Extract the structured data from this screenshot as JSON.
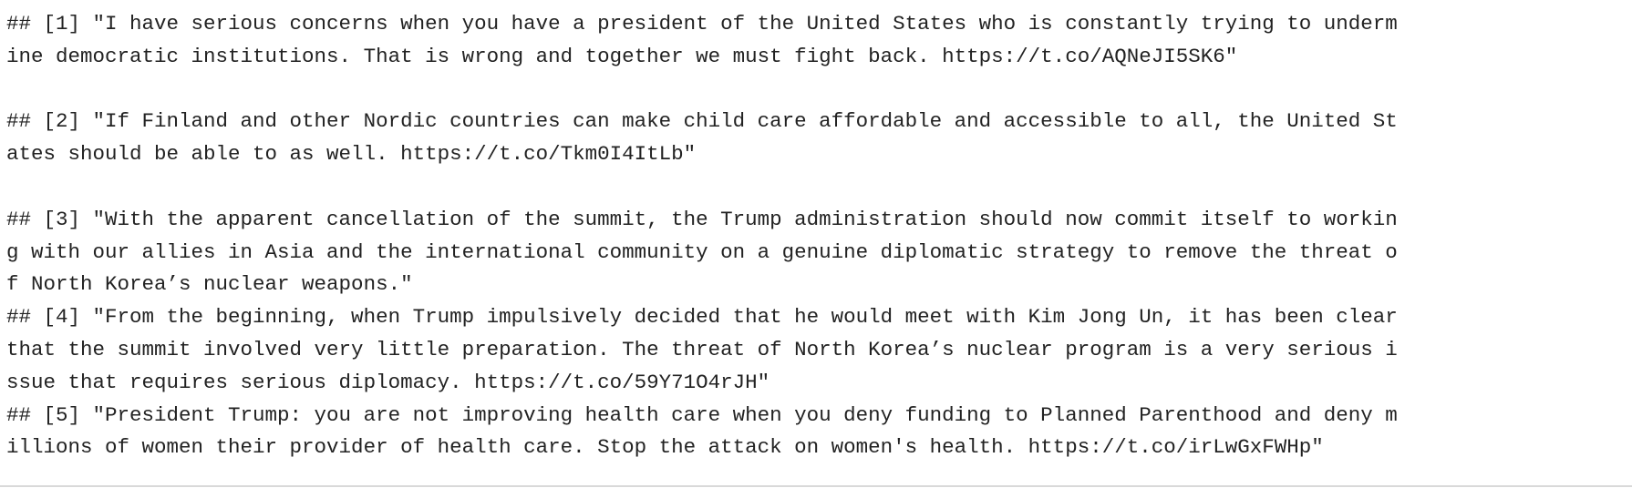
{
  "output": {
    "lines": [
      "## [1] \"I have serious concerns when you have a president of the United States who is constantly trying to underm",
      "ine democratic institutions. That is wrong and together we must fight back. https://t.co/AQNeJI5SK6\"",
      "",
      "## [2] \"If Finland and other Nordic countries can make child care affordable and accessible to all, the United St",
      "ates should be able to as well. https://t.co/Tkm0I4ItLb\"",
      "",
      "## [3] \"With the apparent cancellation of the summit, the Trump administration should now commit itself to workin",
      "g with our allies in Asia and the international community on a genuine diplomatic strategy to remove the threat o",
      "f North Korea’s nuclear weapons.\"",
      "## [4] \"From the beginning, when Trump impulsively decided that he would meet with Kim Jong Un, it has been clear",
      "that the summit involved very little preparation. The threat of North Korea’s nuclear program is a very serious i",
      "ssue that requires serious diplomacy. https://t.co/59Y71O4rJH\"",
      "## [5] \"President Trump: you are not improving health care when you deny funding to Planned Parenthood and deny m",
      "illions of women their provider of health care. Stop the attack on women's health. https://t.co/irLwGxFWHp\""
    ]
  }
}
